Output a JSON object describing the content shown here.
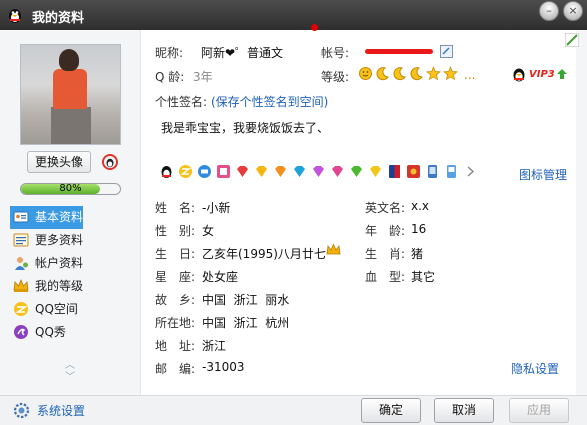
{
  "window": {
    "title": "我的资料",
    "min_glyph": "–",
    "close_glyph": "×"
  },
  "sidebar": {
    "change_avatar_label": "更换头像",
    "progress": {
      "value": 0.8,
      "label": "80%"
    },
    "nav_items": [
      {
        "label": "基本资料",
        "icon": "card-icon",
        "active": true
      },
      {
        "label": "更多资料",
        "icon": "list-icon",
        "active": false
      },
      {
        "label": "帐户资料",
        "icon": "user-icon",
        "active": false
      },
      {
        "label": "我的等级",
        "icon": "crown-icon",
        "active": false
      },
      {
        "label": "QQ空间",
        "icon": "qzone-icon",
        "active": false
      },
      {
        "label": "QQ秀",
        "icon": "qqshow-icon",
        "active": false
      }
    ],
    "scroll_up": "︿",
    "scroll_down": "﹀"
  },
  "profile": {
    "nickname_label": "昵称:",
    "nickname_value": "阿新❤゜普通文",
    "account_label": "帐号:",
    "qage_label": "Q 龄:",
    "qage_value": "3年",
    "level_label": "等级:",
    "level_more": "...",
    "vip_label": "VIP3",
    "signature_label": "个性签名:",
    "save_signature_link": "(保存个性签名到空间)",
    "signature": "我是乖宝宝，我要烧饭饭去了、",
    "icon_manage_link": "图标管理",
    "privacy_link": "隐私设置"
  },
  "fields_left": [
    {
      "label": "姓　名:",
      "value": "-小新"
    },
    {
      "label": "性　别:",
      "value": "女"
    },
    {
      "label": "生　日:",
      "value": "乙亥年(1995)八月廿七"
    },
    {
      "label": "星　座:",
      "value": "处女座"
    },
    {
      "label": "故　乡:",
      "value": "中国  浙江  丽水"
    },
    {
      "label": "所在地:",
      "value": "中国  浙江  杭州"
    },
    {
      "label": "地　址:",
      "value": "浙江"
    },
    {
      "label": "邮　编:",
      "value": "-31003"
    }
  ],
  "fields_right": [
    {
      "label": "英文名:",
      "value": "x.x"
    },
    {
      "label": "年　龄:",
      "value": "16"
    },
    {
      "label": "生　肖:",
      "value": "猪"
    },
    {
      "label": "血　型:",
      "value": "其它"
    }
  ],
  "footer": {
    "settings_label": "系统设置",
    "ok_label": "确定",
    "cancel_label": "取消",
    "apply_label": "应用"
  },
  "colors": {
    "accent": "#3b9ae4",
    "link": "#1d61b5",
    "redacted": "#ea1818",
    "title_bar": "#3a3a3a"
  }
}
